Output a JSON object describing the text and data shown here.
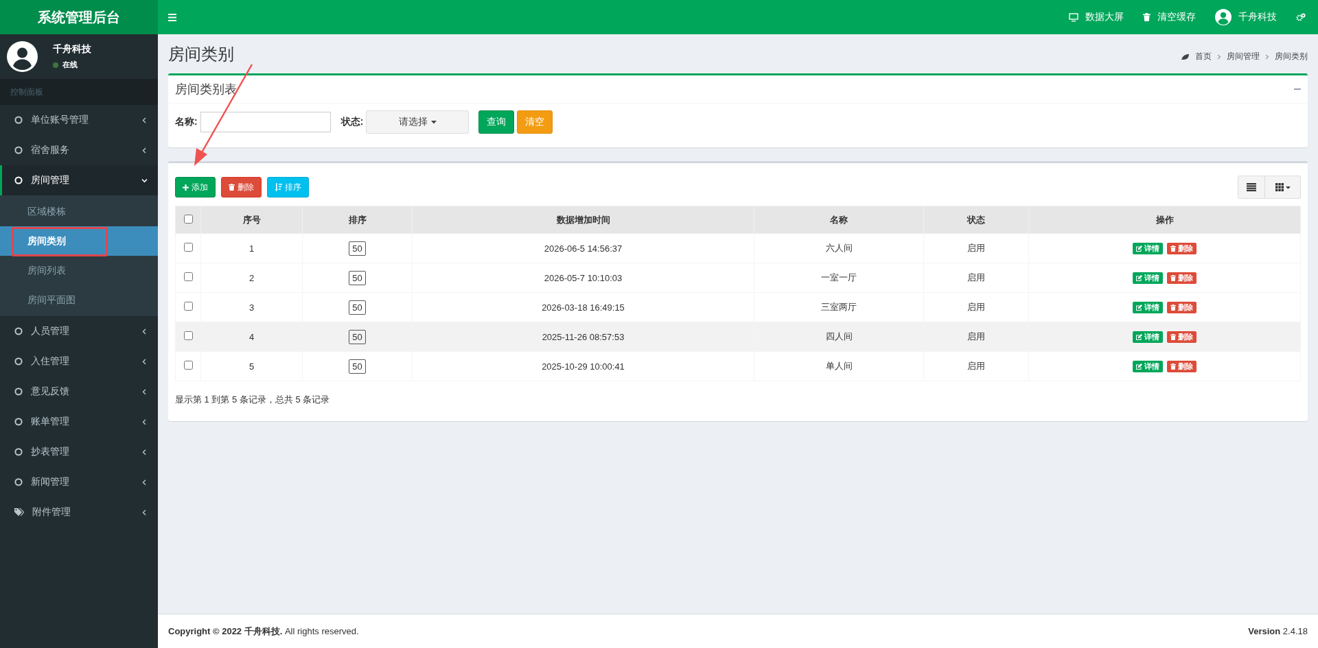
{
  "brand": "系统管理后台",
  "topbar": {
    "links": [
      {
        "label": "数据大屏",
        "kind": "monitor"
      },
      {
        "label": "清空缓存",
        "kind": "trash"
      }
    ],
    "user": "千舟科技"
  },
  "sidebar": {
    "user": {
      "name": "千舟科技",
      "status": "在线"
    },
    "header": "控制面板",
    "items": [
      {
        "label": "单位账号管理",
        "kind": "circle",
        "expanded": false
      },
      {
        "label": "宿舍服务",
        "kind": "circle",
        "expanded": false
      },
      {
        "label": "房间管理",
        "kind": "circle",
        "expanded": true,
        "children": [
          {
            "label": "区域楼栋",
            "selected": false
          },
          {
            "label": "房间类别",
            "selected": true
          },
          {
            "label": "房间列表",
            "selected": false
          },
          {
            "label": "房间平面图",
            "selected": false
          }
        ]
      },
      {
        "label": "人员管理",
        "kind": "circle",
        "expanded": false
      },
      {
        "label": "入住管理",
        "kind": "circle",
        "expanded": false
      },
      {
        "label": "意见反馈",
        "kind": "circle",
        "expanded": false
      },
      {
        "label": "账单管理",
        "kind": "circle",
        "expanded": false
      },
      {
        "label": "抄表管理",
        "kind": "circle",
        "expanded": false
      },
      {
        "label": "新闻管理",
        "kind": "circle",
        "expanded": false
      },
      {
        "label": "附件管理",
        "kind": "tag",
        "expanded": false
      }
    ]
  },
  "page": {
    "title": "房间类别",
    "breadcrumb": [
      "首页",
      "房间管理",
      "房间类别"
    ]
  },
  "filter": {
    "title": "房间类别表",
    "fields": [
      {
        "label": "名称:",
        "kind": "text"
      },
      {
        "label": "状态:",
        "kind": "select",
        "value": "请选择"
      }
    ],
    "buttons": [
      {
        "label": "查询",
        "kind": "primary"
      },
      {
        "label": "清空",
        "kind": "warning"
      }
    ]
  },
  "toolbar": [
    {
      "label": "添加",
      "kind": "add"
    },
    {
      "label": "删除",
      "kind": "delete"
    },
    {
      "label": "排序",
      "kind": "sort"
    }
  ],
  "table": {
    "all_checked": false,
    "columns": [
      "序号",
      "排序",
      "数据增加时间",
      "名称",
      "状态",
      "操作"
    ],
    "rows": [
      {
        "checked": false,
        "highlighted": false,
        "cells": [
          "1",
          "50",
          "2026-06-5 14:56:37",
          "六人间",
          "启用"
        ],
        "actions": [
          "详情",
          "删除"
        ]
      },
      {
        "checked": false,
        "highlighted": false,
        "cells": [
          "2",
          "50",
          "2026-05-7 10:10:03",
          "一室一厅",
          "启用"
        ],
        "actions": [
          "详情",
          "删除"
        ]
      },
      {
        "checked": false,
        "highlighted": false,
        "cells": [
          "3",
          "50",
          "2026-03-18 16:49:15",
          "三室两厅",
          "启用"
        ],
        "actions": [
          "详情",
          "删除"
        ]
      },
      {
        "checked": false,
        "highlighted": true,
        "cells": [
          "4",
          "50",
          "2025-11-26 08:57:53",
          "四人间",
          "启用"
        ],
        "actions": [
          "详情",
          "删除"
        ]
      },
      {
        "checked": false,
        "highlighted": false,
        "cells": [
          "5",
          "50",
          "2025-10-29 10:00:41",
          "单人间",
          "启用"
        ],
        "actions": [
          "详情",
          "删除"
        ]
      }
    ],
    "summary": "显示第 1 到第 5 条记录，总共 5 条记录"
  },
  "footer": {
    "copyright": "**Copyright © 2022 千舟科技.** All rights reserved.",
    "version": "**Version** 2.4.18"
  }
}
